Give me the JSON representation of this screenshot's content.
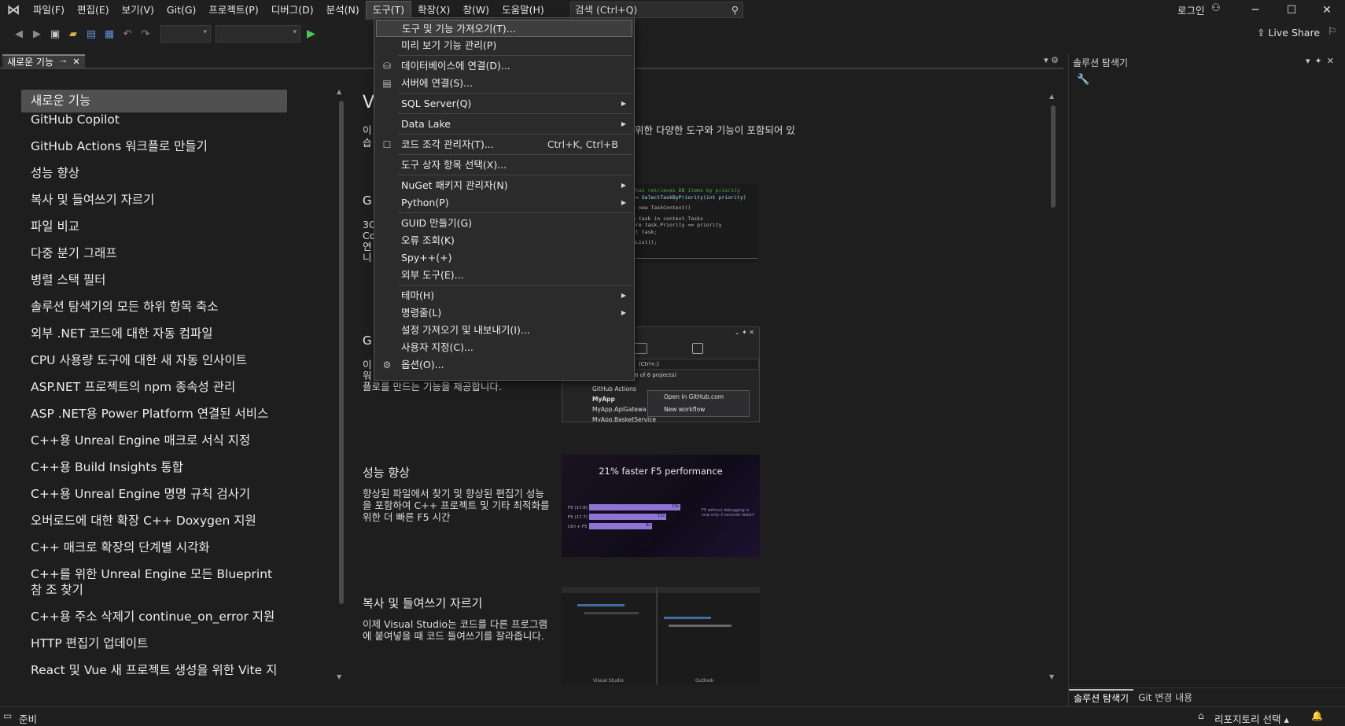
{
  "menubar": {
    "items": [
      "파일(F)",
      "편집(E)",
      "보기(V)",
      "Git(G)",
      "프로젝트(P)",
      "디버그(D)",
      "분석(N)",
      "도구(T)",
      "확장(X)",
      "창(W)",
      "도움말(H)"
    ],
    "search_placeholder": "검색 (Ctrl+Q)",
    "login": "로그인"
  },
  "toolbar": {
    "live_share": "Live Share"
  },
  "doc_tab": {
    "title": "새로운 기능"
  },
  "left_list": {
    "items": [
      "새로운 기능",
      "GitHub Copilot",
      "GitHub Actions 워크플로 만들기",
      "성능 향상",
      "복사 및 들여쓰기 자르기",
      "파일 비교",
      "다중 분기 그래프",
      "병렬 스택 필터",
      "솔루션 탐색기의 모든 하위 항목 축소",
      "외부 .NET 코드에 대한 자동 컴파일",
      "CPU 사용량 도구에 대한 새 자동 인사이트",
      "ASP.NET 프로젝트의 npm 종속성 관리",
      "ASP .NET용 Power Platform 연결된 서비스",
      "C++용 Unreal Engine 매크로 서식 지정",
      "C++용 Build Insights 통합",
      "C++용 Unreal Engine 명명 규칙 검사기",
      "오버로드에 대한 확장 C++ Doxygen 지원",
      "C++ 매크로 확장의 단계별 시각화",
      "C++를 위한 Unreal Engine 모든 Blueprint 참 조 찾기",
      "C++용 주소 삭제기 continue_on_error 지원",
      "HTTP 편집기 업데이트",
      "React 및 Vue 새 프로젝트 생성을 위한 Vite 지"
    ]
  },
  "main": {
    "heading_fragment": "V",
    "intro_l1_start": "이",
    "intro_l1_end": "위한 다양한 도구와 기능이 포함되어 있",
    "intro_l2_start": "습",
    "sec1_heading": "G",
    "sec1_lines": [
      "3C",
      "Co",
      "연",
      "니"
    ],
    "sec2_heading": "G",
    "sec2_lines": [
      "이",
      "워"
    ],
    "sec2_l3": "플로를 만드는 기능을 제공합니다.",
    "perf_heading": "성능 향상",
    "perf_text": "향상된 파일에서 찾기 및 향상된 편집기 성능을 포함하여 C++ 프로젝트 및 기타 최적화를 위한 더 빠른 F5 시간",
    "copy_heading": "복사 및 들여쓰기 자르기",
    "copy_text": "이제 Visual Studio는 코드를 다른 프로그램에 붙여넣을 때 코드 들여쓰기를 잘라줍니다.",
    "code_lines": [
      "that retrieves DB items by priority",
      "(= SelectTaskByPriority(int priority)",
      "= new TaskContext()",
      "m task in context.Tasks",
      "ere task.Priority == priority",
      "ct task;",
      "oList();"
    ],
    "gh_shot": {
      "search": "(Ctrl+;)",
      "projects": "6 of 6 projects)",
      "rows": [
        "GitHub Actions",
        "MyApp",
        "MyApp.ApiGatewa",
        "MyApp.BasketService"
      ],
      "ctx": [
        "Open in GitHub.com",
        "New workflow"
      ]
    },
    "perf_shot": {
      "title": "21% faster F5 performance",
      "bars": [
        {
          "label": "F5 (17.6)",
          "value": "13s"
        },
        {
          "label": "F5 (17.7)",
          "value": "11s"
        },
        {
          "label": "Ctrl + F5",
          "value": "9s"
        }
      ],
      "note": "F5 without debugging is now only 2 seconds faster!"
    },
    "copy_shot": {
      "labels": [
        "Visual Studio",
        "Outlook"
      ]
    }
  },
  "tools_menu": {
    "items": [
      {
        "label": "도구 및 기능 가져오기(T)...",
        "highlighted": true
      },
      {
        "label": "미리 보기 기능 관리(P)"
      },
      {
        "label": "데이터베이스에 연결(D)...",
        "icon": "database-icon"
      },
      {
        "label": "서버에 연결(S)...",
        "icon": "server-icon"
      },
      {
        "label": "SQL Server(Q)",
        "submenu": true
      },
      {
        "label": "Data Lake",
        "submenu": true
      },
      {
        "label": "코드 조각 관리자(T)...",
        "shortcut": "Ctrl+K, Ctrl+B",
        "icon": "checkbox-icon"
      },
      {
        "label": "도구 상자 항목 선택(X)..."
      },
      {
        "label": "NuGet 패키지 관리자(N)",
        "submenu": true
      },
      {
        "label": "Python(P)",
        "submenu": true
      },
      {
        "label": "GUID 만들기(G)"
      },
      {
        "label": "오류 조회(K)"
      },
      {
        "label": "Spy++(+)"
      },
      {
        "label": "외부 도구(E)..."
      },
      {
        "label": "테마(H)",
        "submenu": true
      },
      {
        "label": "명령줄(L)",
        "submenu": true
      },
      {
        "label": "설정 가져오기 및 내보내기(I)..."
      },
      {
        "label": "사용자 지정(C)..."
      },
      {
        "label": "옵션(O)...",
        "icon": "gear-icon"
      }
    ]
  },
  "solution_explorer": {
    "title": "솔루션 탐색기",
    "tab_a": "솔루션 탐색기",
    "tab_b": "Git 변경 내용"
  },
  "statusbar": {
    "ready": "준비",
    "repo": "리포지토리 선택"
  }
}
